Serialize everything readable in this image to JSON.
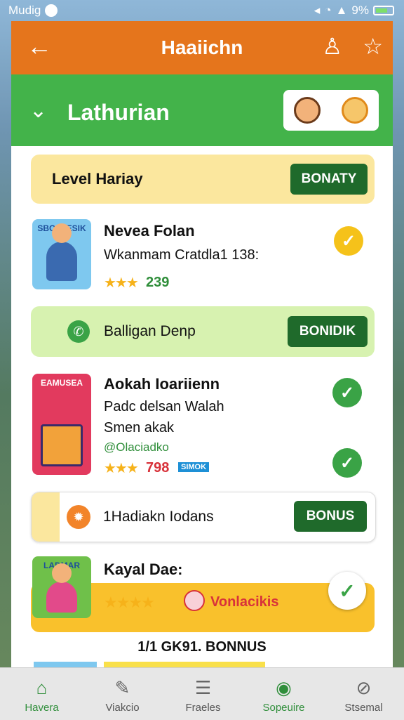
{
  "status": {
    "carrier": "Mudig",
    "battery": "9%"
  },
  "header": {
    "title": "Haaiichn",
    "back_icon": "arrow-left-icon",
    "bell_icon": "bell-icon",
    "star_icon": "star-icon"
  },
  "hero": {
    "title": "Lathurian"
  },
  "level_banner": {
    "label": "Level Hariay",
    "button": "BONATY"
  },
  "item1": {
    "thumb_title": "SBOLSESIK",
    "title": "Nevea Folan",
    "subtitle": "Wkanmam Cratdla1 138:",
    "rating": "★★★",
    "count": "239"
  },
  "bonus_banner1": {
    "label": "Balligan Denp",
    "button": "BONIDIK"
  },
  "item2": {
    "thumb_title": "EAMUSEA",
    "title": "Aokah Ioariienn",
    "line1": "Padc delsan Walah",
    "line2": "Smen akak",
    "tag": "@Olaciadko",
    "rating": "★★★",
    "count": "798",
    "badge": "SIMOK"
  },
  "bonus_banner2": {
    "label": "1Hadiakn Iodans",
    "button": "BONUS"
  },
  "item3": {
    "thumb_title": "LADMAR",
    "title": "Kayal Dae:",
    "rating": "★★★★",
    "label": "Vonlacikis"
  },
  "footer_text": "1/1 GK91. BONNUS",
  "nav": [
    {
      "label": "Havera",
      "icon": "home-icon"
    },
    {
      "label": "Viakcio",
      "icon": "tools-icon"
    },
    {
      "label": "Fraeles",
      "icon": "document-icon"
    },
    {
      "label": "Sopeuire",
      "icon": "target-icon"
    },
    {
      "label": "Stsemal",
      "icon": "compass-icon"
    }
  ]
}
